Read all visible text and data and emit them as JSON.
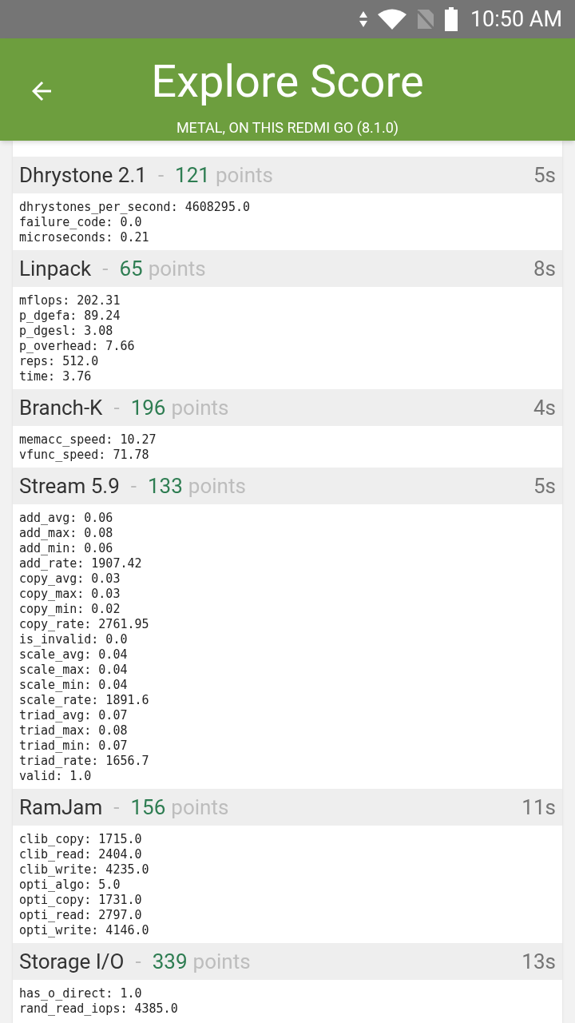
{
  "status_bar": {
    "time": "10:50 AM"
  },
  "header": {
    "title": "Explore Score",
    "subtitle": "METAL, ON THIS REDMI GO (8.1.0)"
  },
  "results": [
    {
      "name": "Dhrystone 2.1",
      "separator": "-",
      "score": "121",
      "unit": "points",
      "duration": "5s",
      "metrics": [
        "dhrystones_per_second: 4608295.0",
        "failure_code: 0.0",
        "microseconds: 0.21"
      ]
    },
    {
      "name": "Linpack",
      "separator": "-",
      "score": "65",
      "unit": "points",
      "duration": "8s",
      "metrics": [
        "mflops: 202.31",
        "p_dgefa: 89.24",
        "p_dgesl: 3.08",
        "p_overhead: 7.66",
        "reps: 512.0",
        "time: 3.76"
      ]
    },
    {
      "name": "Branch-K",
      "separator": "-",
      "score": "196",
      "unit": "points",
      "duration": "4s",
      "metrics": [
        "memacc_speed: 10.27",
        "vfunc_speed: 71.78"
      ]
    },
    {
      "name": "Stream 5.9",
      "separator": "-",
      "score": "133",
      "unit": "points",
      "duration": "5s",
      "metrics": [
        "add_avg: 0.06",
        "add_max: 0.08",
        "add_min: 0.06",
        "add_rate: 1907.42",
        "copy_avg: 0.03",
        "copy_max: 0.03",
        "copy_min: 0.02",
        "copy_rate: 2761.95",
        "is_invalid: 0.0",
        "scale_avg: 0.04",
        "scale_max: 0.04",
        "scale_min: 0.04",
        "scale_rate: 1891.6",
        "triad_avg: 0.07",
        "triad_max: 0.08",
        "triad_min: 0.07",
        "triad_rate: 1656.7",
        "valid: 1.0"
      ]
    },
    {
      "name": "RamJam",
      "separator": "-",
      "score": "156",
      "unit": "points",
      "duration": "11s",
      "metrics": [
        "clib_copy: 1715.0",
        "clib_read: 2404.0",
        "clib_write: 4235.0",
        "opti_algo: 5.0",
        "opti_copy: 1731.0",
        "opti_read: 2797.0",
        "opti_write: 4146.0"
      ]
    },
    {
      "name": "Storage I/O",
      "separator": "-",
      "score": "339",
      "unit": "points",
      "duration": "13s",
      "metrics": [
        "has_o_direct: 1.0",
        "rand_read_iops: 4385.0"
      ]
    }
  ]
}
